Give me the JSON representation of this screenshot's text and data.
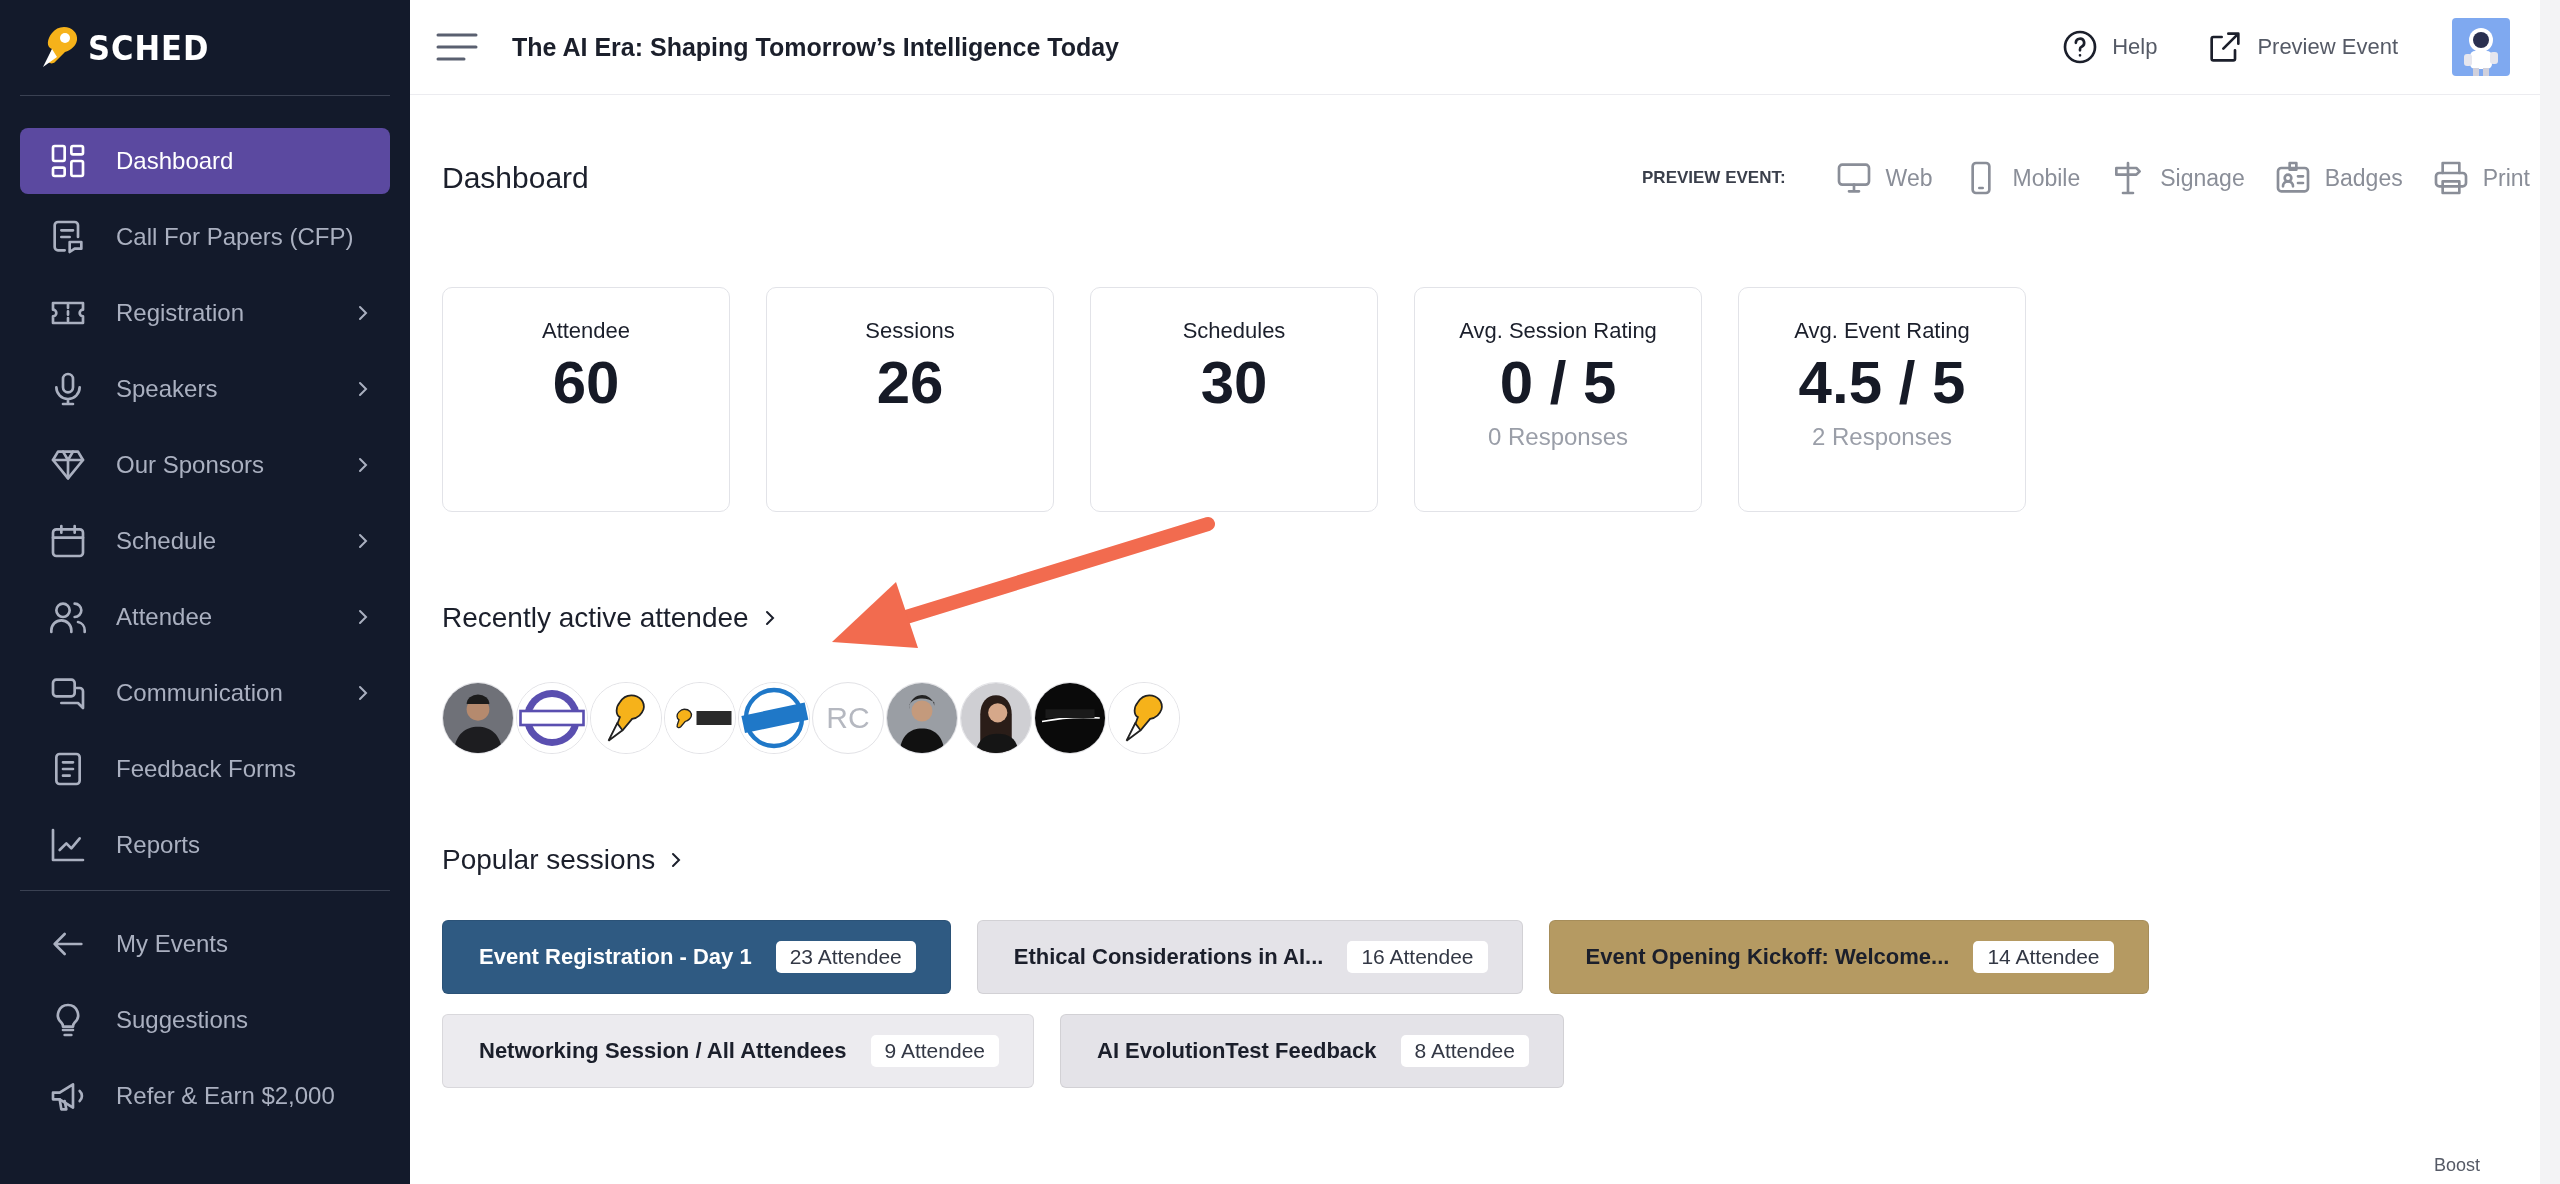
{
  "brand": {
    "name": "SCHED"
  },
  "sidebar": {
    "items": [
      {
        "label": "Dashboard",
        "selected": true,
        "expandable": false
      },
      {
        "label": "Call For Papers (CFP)",
        "selected": false,
        "expandable": false
      },
      {
        "label": "Registration",
        "selected": false,
        "expandable": true
      },
      {
        "label": "Speakers",
        "selected": false,
        "expandable": true
      },
      {
        "label": "Our Sponsors",
        "selected": false,
        "expandable": true
      },
      {
        "label": "Schedule",
        "selected": false,
        "expandable": true
      },
      {
        "label": "Attendee",
        "selected": false,
        "expandable": true
      },
      {
        "label": "Communication",
        "selected": false,
        "expandable": true
      },
      {
        "label": "Feedback Forms",
        "selected": false,
        "expandable": false
      },
      {
        "label": "Reports",
        "selected": false,
        "expandable": false
      }
    ],
    "footer_items": [
      {
        "label": "My Events"
      },
      {
        "label": "Suggestions"
      },
      {
        "label": "Refer & Earn $2,000"
      }
    ]
  },
  "top_bar": {
    "title": "The AI Era: Shaping Tomorrow’s Intelligence Today",
    "links": [
      {
        "label": "Help"
      },
      {
        "label": "Preview Event"
      }
    ]
  },
  "page": {
    "title": "Dashboard",
    "preview_label": "PREVIEW EVENT:",
    "preview_options": [
      {
        "label": "Web"
      },
      {
        "label": "Mobile"
      },
      {
        "label": "Signage"
      },
      {
        "label": "Badges"
      },
      {
        "label": "Print"
      }
    ]
  },
  "stats": [
    {
      "label": "Attendee",
      "value": "60"
    },
    {
      "label": "Sessions",
      "value": "26"
    },
    {
      "label": "Schedules",
      "value": "30"
    },
    {
      "label": "Avg. Session Rating",
      "value": "0 / 5",
      "sub": "0 Responses"
    },
    {
      "label": "Avg. Event Rating",
      "value": "4.5 / 5",
      "sub": "2 Responses"
    }
  ],
  "recent_attendees": {
    "title": "Recently active attendee",
    "items": [
      {
        "kind": "picture"
      },
      {
        "kind": "picture"
      },
      {
        "kind": "picture"
      },
      {
        "kind": "picture"
      },
      {
        "kind": "picture"
      },
      {
        "kind": "initials",
        "initials": "RC"
      },
      {
        "kind": "picture"
      },
      {
        "kind": "picture"
      },
      {
        "kind": "picture"
      },
      {
        "kind": "picture"
      }
    ]
  },
  "popular_sessions": {
    "title": "Popular sessions",
    "items": [
      {
        "title": "Event Registration - Day 1",
        "count": "23 Attendee",
        "color": "#2f5a82"
      },
      {
        "title": "Ethical Considerations in AI...",
        "count": "16 Attendee",
        "color": "#e4e3e8"
      },
      {
        "title": "Event Opening Kickoff: Welcome...",
        "count": "14 Attendee",
        "color": "#b59a62"
      },
      {
        "title": "Networking Session / All Attendees",
        "count": "9 Attendee",
        "color": "#ecebef"
      },
      {
        "title": "AI EvolutionTest Feedback",
        "count": "8 Attendee",
        "color": "#e4e3e8"
      }
    ]
  },
  "footer": {
    "label": "Boost"
  }
}
